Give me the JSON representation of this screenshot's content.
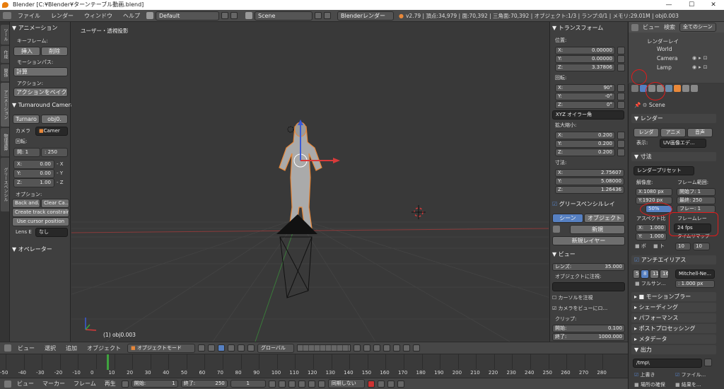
{
  "window": {
    "title": "Blender [C:¥Blender¥ターンテーブル動画.blend]",
    "min": "—",
    "max": "☐",
    "close": "✕"
  },
  "info_header": {
    "menus": [
      "ファイル",
      "レンダー",
      "ウィンドウ",
      "ヘルプ"
    ],
    "layout": "Default",
    "scene": "Scene",
    "engine": "Blenderレンダー",
    "stats": "v2.79 | 頂点:34,979 | 面:70,392 | 三角面:70,392 | オブジェクト:1/3 | ランプ:0/1 | メモリ:29.01M | obj0.003"
  },
  "tool_shelf": {
    "tabs": [
      "ツール",
      "作成",
      "関係",
      "アニメーション",
      "物理演算",
      "グリースペンシル"
    ],
    "animation_header": "▼ アニメーション",
    "keyframe_label": "キーフレーム:",
    "insert": "挿入",
    "delete": "削除",
    "motion_path_label": "モーションパス:",
    "calculate": "計算",
    "action_label": "アクション:",
    "bake_action": "アクションをベイク",
    "turnaround_header": "▼ Turnaround Camera",
    "turnaround_btn": "Turnaro",
    "obj_btn": "obj0.",
    "camera_label": "カメラ",
    "camera_value": "Camer",
    "rotation_label": "回転:",
    "start": "開: 1",
    "end": ": 250",
    "x": "X:",
    "x_val": "0.00",
    "y": "Y:",
    "y_val": "0.00",
    "z": "Z:",
    "z_val": "1.00",
    "x_btn": "- X",
    "y_btn": "- Y",
    "z_btn": "- Z",
    "options_label": "オプション:",
    "back_and": "Back and...",
    "clear_ca": "Clear Ca...",
    "create_track": "Create track constraint",
    "use_cursor": "Use cursor position",
    "lens_label": "Lens E",
    "lens_value": "なし",
    "operator_header": "▼ オペレーター"
  },
  "viewport": {
    "view_label": "ユーザー・透視投影",
    "object_label": "(1) obj0.003"
  },
  "properties_panel": {
    "transform_header": "▼ トランスフォーム",
    "location_label": "位置:",
    "loc": [
      "X:",
      "0.00000",
      "Y:",
      "0.00000",
      "Z:",
      "3.37806"
    ],
    "rotation_label": "回転:",
    "rot": [
      "X:",
      "90°",
      "Y:",
      "-0°",
      "Z:",
      "0°"
    ],
    "rot_mode": "XYZ オイラー角",
    "scale_label": "拡大縮小:",
    "scale": [
      "X:",
      "0.200",
      "Y:",
      "0.200",
      "Z:",
      "0.200"
    ],
    "dim_label": "寸法:",
    "dim": [
      "X:",
      "2.75607",
      "Y:",
      "5.08000",
      "Z:",
      "1.26436"
    ],
    "gp_header": "グリースペンシルレイ",
    "scene_tab": "シーン",
    "object_tab": "オブジェクト",
    "new_btn": "新規",
    "new_layer": "新規レイヤー",
    "view_header": "▼ ビュー",
    "lens": "レンズ:",
    "lens_val": "35.000",
    "lock_obj": "オブジェクトに注視:",
    "lock_cursor": "カーソルを注視",
    "lock_cam": "カメラをビューにロ...",
    "clip": "クリップ:",
    "clip_start": "開始:",
    "clip_start_val": "0.100",
    "clip_end": "終了:",
    "clip_end_val": "1000.000"
  },
  "outliner": {
    "view": "ビュー",
    "search": "検索",
    "scenes": "全てのシーン",
    "items": [
      "レンダーレイ",
      "World",
      "Camera",
      "Lamp"
    ]
  },
  "render_props": {
    "scene": "Scene",
    "render_header": "▼ レンダー",
    "render_btn": "レンダ",
    "anim_btn": "アニメ",
    "audio_btn": "音声",
    "display_label": "表示:",
    "display_val": "UV画像エデ...",
    "dimensions_header": "▼ 寸法",
    "preset": "レンダープリセット",
    "resolution_label": "解像度:",
    "res_x": "X:1080 px",
    "res_y": "Y:1920 px",
    "res_pct": "50%",
    "frame_range_label": "フレーム範囲:",
    "frame_start": "開始フ: 1",
    "frame_end": "最終: 250",
    "frame_step": "フレー: 1",
    "aspect_label": "アスペクト比",
    "asp_x": "X:",
    "asp_x_val": "1.000",
    "asp_y": "Y:",
    "asp_y_val": "1.000",
    "frame_rate_label": "フレームレー",
    "fps": "24 fps",
    "time_remap": "タイムリマップ",
    "old": "10",
    "new": "10",
    "border": "ボ",
    "crop": "ト",
    "aa_header": "アンチエイリアス",
    "aa_samples": [
      "5",
      "8",
      "11",
      "16"
    ],
    "aa_filter": "Mitchell-Ne...",
    "full_sample": "フルサン...",
    "filter_size": ": 1.000 px",
    "motion_blur": "モーションブラー",
    "shading": "シェーディング",
    "performance": "パフォーマンス",
    "postprocess": "ポストプロセッシング",
    "metadata": "メタデータ",
    "output_header": "▼ 出力",
    "output_path": "/tmp\\",
    "overwrite": "上書き",
    "file_ext": "ファイル...",
    "placeholders": "場所の確保",
    "cache": "結果を..."
  },
  "view3d_header": {
    "view": "ビュー",
    "select": "選択",
    "add": "追加",
    "object": "オブジェクト",
    "mode": "オブジェクトモード",
    "orientation": "グローバル"
  },
  "timeline": {
    "ticks": [
      "-50",
      "-40",
      "-30",
      "-20",
      "-10",
      "0",
      "10",
      "20",
      "30",
      "40",
      "50",
      "60",
      "70",
      "80",
      "90",
      "100",
      "110",
      "120",
      "130",
      "140",
      "150",
      "160",
      "170",
      "180",
      "190",
      "200",
      "210",
      "220",
      "230",
      "240",
      "250",
      "260",
      "270",
      "280"
    ],
    "view": "ビュー",
    "marker": "マーカー",
    "frame": "フレーム",
    "play": "再生",
    "start": "開始:",
    "start_val": "1",
    "end": "終了:",
    "end_val": "250",
    "current": "1",
    "sync": "同期しない"
  },
  "colors": {
    "orange": "#e8883a",
    "red_annotation": "#e21b1b",
    "selected_blue": "#5680c2"
  }
}
